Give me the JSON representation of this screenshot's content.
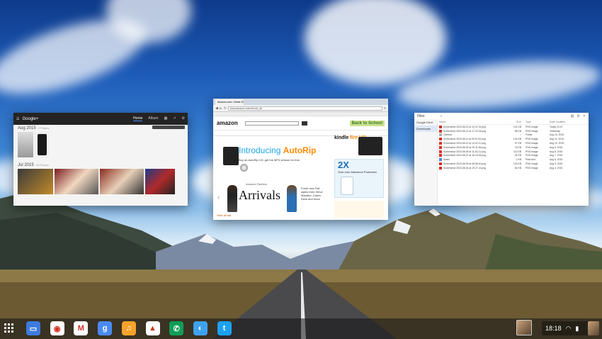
{
  "photos_window": {
    "brand": "Google+",
    "tabs": [
      "Home",
      "Album"
    ],
    "section1": "Aug 2015",
    "section1_sub": "2 Photos",
    "section2": "Jul 2015",
    "section2_sub": "14 Photos"
  },
  "browser_window": {
    "tab_label": "Amazon.com: Online Shopping",
    "url": "www.amazon.com/ref=nb_sb",
    "logo": "amazon",
    "bts": "Back to School",
    "autorip_title_a": "Introducing",
    "autorip_title_b": "AutoRip",
    "autorip_sub": "Buy an AutoRip CD, get the MP3 version for free",
    "kindle_a": "kindle",
    "kindle_b": "fire HD",
    "twox_big": "2X",
    "twox_text": "Sure men Maximum Protection",
    "arrivals_small": "Amazon Fashion",
    "arrivals_word": "Arrivals",
    "arrivals_side": "Fresh new Fall styles from Steve Madden, Calvin Klein and more",
    "view_all": "View all fall"
  },
  "files_window": {
    "title": "Files",
    "sidebar": [
      "Google Drive",
      "Downloads"
    ],
    "columns": [
      "Name",
      "Size",
      "Type",
      "Date modified"
    ],
    "rows": [
      {
        "name": "Screenshot 2015-08-13 at 10.47.15.png",
        "size": "101 KB",
        "type": "PNG image",
        "date": "Today 10:47"
      },
      {
        "name": "Screenshot 2015-08-12 at 17.22.04.png",
        "size": "88 KB",
        "type": "PNG image",
        "date": "Yesterday"
      },
      {
        "name": "Camera",
        "size": "--",
        "type": "Folder",
        "date": "Aug 10, 2015"
      },
      {
        "name": "Screenshot 2015-08-11 at 09.10.33.png",
        "size": "124 KB",
        "type": "PNG image",
        "date": "Aug 11, 2015"
      },
      {
        "name": "Screenshot 2015-08-10 at 14.02.11.png",
        "size": "97 KB",
        "type": "PNG image",
        "date": "Aug 10, 2015"
      },
      {
        "name": "Screenshot 2015-08-09 at 20.31.55.png",
        "size": "76 KB",
        "type": "PNG image",
        "date": "Aug 9, 2015"
      },
      {
        "name": "Screenshot 2015-08-08 at 11.44.21.png",
        "size": "112 KB",
        "type": "PNG image",
        "date": "Aug 8, 2015"
      },
      {
        "name": "Screenshot 2015-08-07 at 16.15.09.png",
        "size": "91 KB",
        "type": "PNG image",
        "date": "Aug 7, 2015"
      },
      {
        "name": "Notes",
        "size": "2 KB",
        "type": "Plain text",
        "date": "Aug 6, 2015"
      },
      {
        "name": "Screenshot 2015-08-05 at 08.58.40.png",
        "size": "103 KB",
        "type": "PNG image",
        "date": "Aug 5, 2015"
      },
      {
        "name": "Screenshot 2015-08-04 at 19.27.13.png",
        "size": "84 KB",
        "type": "PNG image",
        "date": "Aug 4, 2015"
      }
    ]
  },
  "shelf": {
    "apps": [
      {
        "name": "files-app",
        "color": "#3d7be0",
        "glyph": "▭"
      },
      {
        "name": "chrome-app",
        "color": "#ffffff",
        "glyph": "◉"
      },
      {
        "name": "gmail-app",
        "color": "#ffffff",
        "glyph": "M"
      },
      {
        "name": "google-search-app",
        "color": "#4a8af4",
        "glyph": "g"
      },
      {
        "name": "play-music-app",
        "color": "#f7a22b",
        "glyph": "♫"
      },
      {
        "name": "google-drive-app",
        "color": "#ffffff",
        "glyph": "▲"
      },
      {
        "name": "hangouts-app",
        "color": "#0f9d58",
        "glyph": "✆"
      },
      {
        "name": "photos-app",
        "color": "#3ea2f0",
        "glyph": "◐"
      },
      {
        "name": "twitter-app",
        "color": "#1da1f2",
        "glyph": "t"
      }
    ],
    "time": "18:18"
  },
  "colors": {
    "accent": "#4c8bf5",
    "amazon_orange": "#ff8a00",
    "autorip_blue": "#1ea6df"
  }
}
